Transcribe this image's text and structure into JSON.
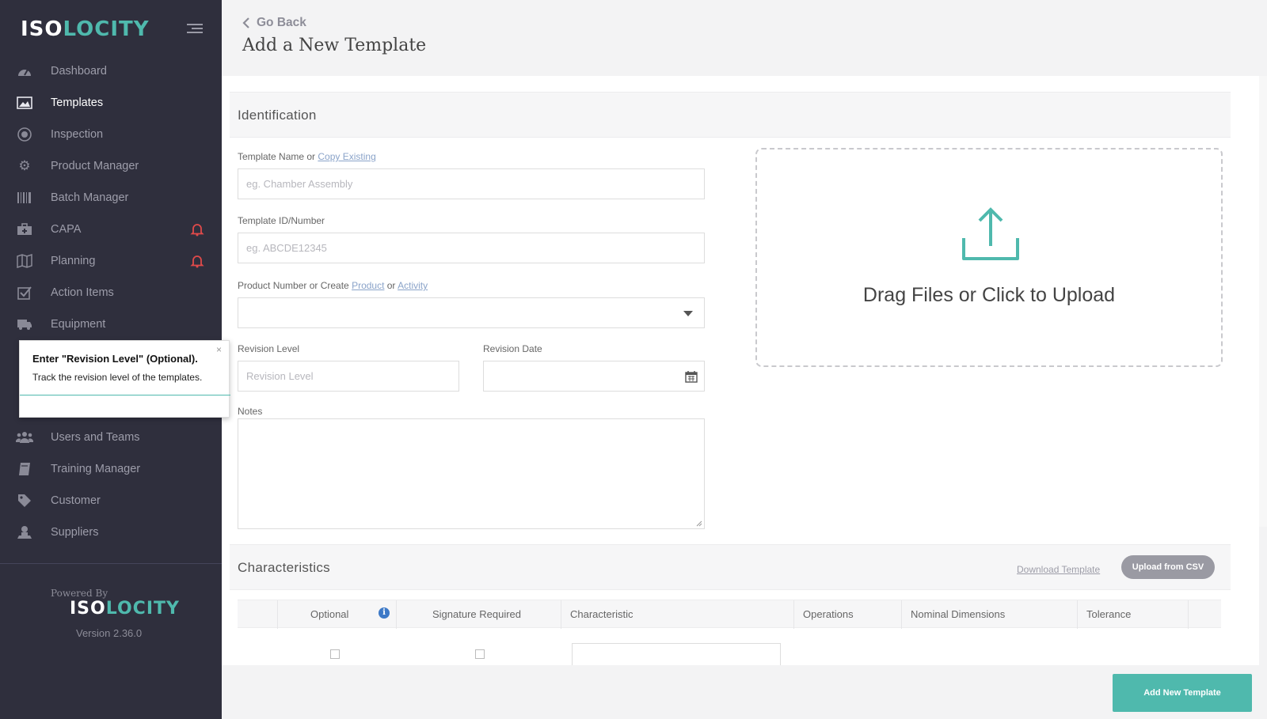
{
  "brand": {
    "logo_left": "IS",
    "logo_o": "O",
    "logo_right": "LOCITY"
  },
  "sidebar": {
    "items": [
      {
        "label": "Dashboard",
        "icon": "dashboard-gauge-icon"
      },
      {
        "label": "Templates",
        "icon": "image-icon",
        "active": true
      },
      {
        "label": "Inspection",
        "icon": "target-icon"
      },
      {
        "label": "Product Manager",
        "icon": "gear-icon"
      },
      {
        "label": "Batch Manager",
        "icon": "barcode-icon"
      },
      {
        "label": "CAPA",
        "icon": "medkit-icon",
        "alert": true
      },
      {
        "label": "Planning",
        "icon": "map-icon",
        "alert": true
      },
      {
        "label": "Action Items",
        "icon": "checkbox-icon"
      },
      {
        "label": "Equipment",
        "icon": "truck-icon"
      },
      {
        "label": "Users and Teams",
        "icon": "users-icon"
      },
      {
        "label": "Training Manager",
        "icon": "book-icon"
      },
      {
        "label": "Customer",
        "icon": "tag-icon"
      },
      {
        "label": "Suppliers",
        "icon": "supplier-icon"
      }
    ],
    "footer": {
      "powered_by": "Powered By",
      "version": "Version 2.36.0"
    }
  },
  "tooltip": {
    "title": "Enter \"Revision Level\" (Optional).",
    "text": "Track the revision level of the templates.",
    "close": "×"
  },
  "header": {
    "go_back": "Go Back",
    "title": "Add a New Template"
  },
  "identification": {
    "title": "Identification",
    "template_name_label": "Template Name or ",
    "copy_existing": "Copy Existing",
    "template_name_placeholder": "eg. Chamber Assembly",
    "template_id_label": "Template ID/Number",
    "template_id_placeholder": "eg. ABCDE12345",
    "product_label": "Product Number or Create ",
    "product_link": "Product",
    "or_text": " or ",
    "activity_link": "Activity",
    "revision_level_label": "Revision Level",
    "revision_level_placeholder": "Revision Level",
    "revision_date_label": "Revision Date",
    "notes_label": "Notes",
    "upload_text": "Drag Files or Click to Upload"
  },
  "characteristics": {
    "title": "Characteristics",
    "download_template": "Download Template",
    "upload_csv": "Upload from CSV",
    "columns": [
      "Optional",
      "Signature Required",
      "Characteristic",
      "Operations",
      "Nominal Dimensions",
      "Tolerance"
    ]
  },
  "footer": {
    "add_button": "Add New Template"
  },
  "colors": {
    "sidebar_bg": "#2f2f3d",
    "accent": "#4fb9ad",
    "alert": "#e04a4a"
  }
}
